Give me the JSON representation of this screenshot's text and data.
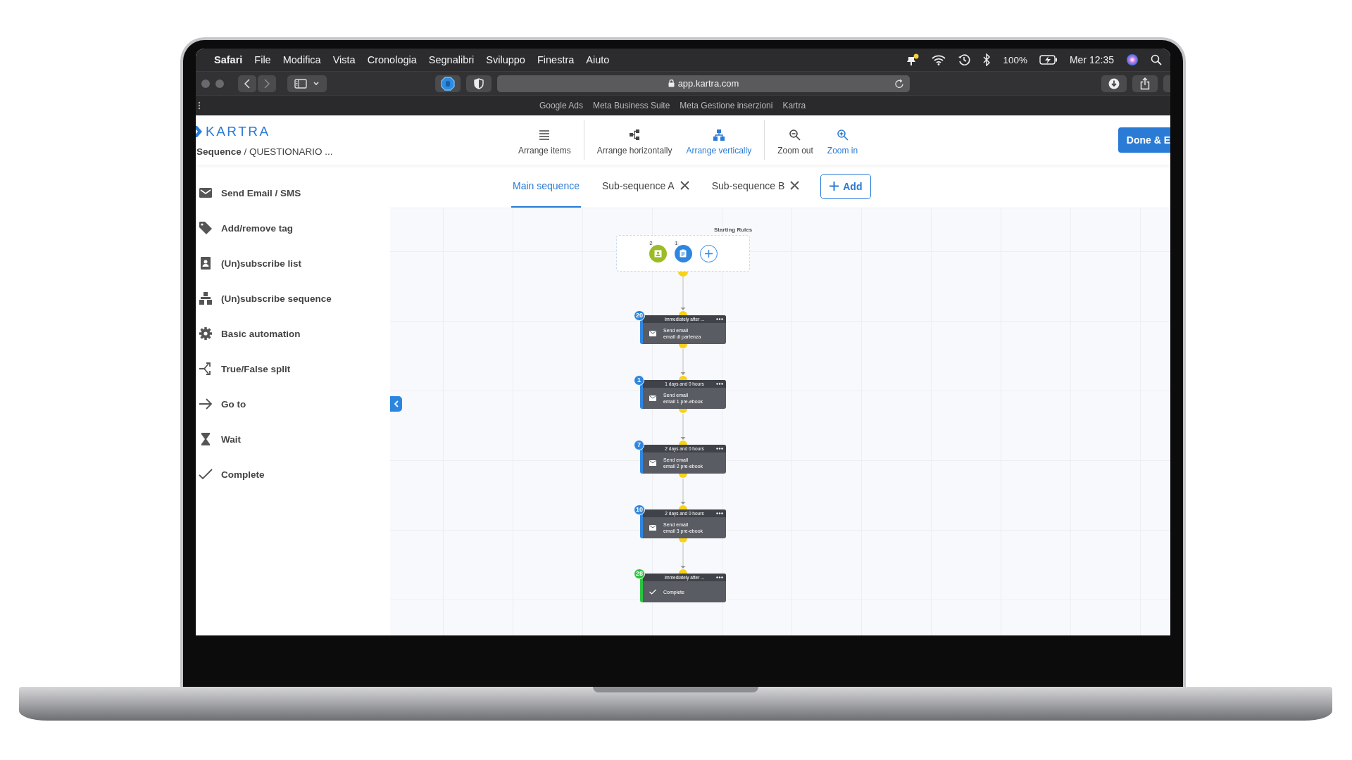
{
  "menu_bar": {
    "app": "Safari",
    "menus": [
      "File",
      "Modifica",
      "Vista",
      "Cronologia",
      "Segnalibri",
      "Sviluppo",
      "Finestra",
      "Aiuto"
    ],
    "battery": "100%",
    "clock": "Mer 12:35"
  },
  "browser": {
    "url": "app.kartra.com",
    "bookmarks": [
      "Google Ads",
      "Meta Business Suite",
      "Meta Gestione inserzioni",
      "Kartra"
    ]
  },
  "app_header": {
    "logo": "KARTRA",
    "breadcrumb": "**Sequence** / QUESTIONARIO ...",
    "toolbar": [
      {
        "label": "Arrange items",
        "highlighted": false
      },
      {
        "label": "Arrange horizontally",
        "highlighted": false
      },
      {
        "label": "Arrange vertically",
        "highlighted": true
      },
      {
        "label": "Zoom out",
        "highlighted": false
      },
      {
        "label": "Zoom in",
        "highlighted": true
      }
    ],
    "done_button": "Done & E"
  },
  "sidebar": {
    "items": [
      {
        "label": "Send Email / SMS"
      },
      {
        "label": "Add/remove tag"
      },
      {
        "label": "(Un)subscribe list"
      },
      {
        "label": "(Un)subscribe sequence"
      },
      {
        "label": "Basic automation"
      },
      {
        "label": "True/False split"
      },
      {
        "label": "Go to"
      },
      {
        "label": "Wait"
      },
      {
        "label": "Complete"
      }
    ]
  },
  "tabs": [
    {
      "label": "Main sequence",
      "selected": true,
      "closable": false
    },
    {
      "label": "Sub-sequence A",
      "selected": false,
      "closable": true
    },
    {
      "label": "Sub-sequence B",
      "selected": false,
      "closable": true
    }
  ],
  "add_button": "Add",
  "canvas": {
    "starting_rules": {
      "title": "Starting Rules",
      "triggers": [
        {
          "count": "2",
          "color": "#9cbb27"
        },
        {
          "count": "1",
          "color": "#2f86de"
        }
      ]
    },
    "nodes": [
      {
        "badge": "20",
        "color": "#2f86de",
        "delay": "Immediately after ...",
        "kind": "email",
        "action": "Send email",
        "detail": "email di partenza"
      },
      {
        "badge": "1",
        "color": "#2f86de",
        "delay": "1 days and 0 hours",
        "kind": "email",
        "action": "Send email",
        "detail": "email 1 pre-ebook"
      },
      {
        "badge": "7",
        "color": "#2f86de",
        "delay": "2 days and 0 hours",
        "kind": "email",
        "action": "Send email",
        "detail": "email 2 pre-ebook"
      },
      {
        "badge": "10",
        "color": "#2f86de",
        "delay": "2 days and 0 hours",
        "kind": "email",
        "action": "Send email",
        "detail": "email 3 pre-ebook"
      },
      {
        "badge": "28",
        "color": "#2bc43f",
        "delay": "Immediately after ...",
        "kind": "complete",
        "action": "Complete"
      }
    ]
  }
}
